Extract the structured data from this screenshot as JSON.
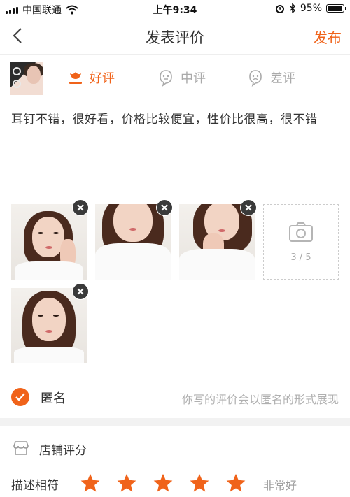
{
  "status_bar": {
    "carrier": "中国联通",
    "time": "上午9:34",
    "battery": "95%",
    "battery_level": 0.95
  },
  "nav": {
    "title": "发表评价",
    "publish_label": "发布",
    "icons": {
      "back": "chevron-left-icon"
    }
  },
  "rating_tabs": [
    {
      "label": "好评",
      "icon": "flower-icon",
      "selected": true
    },
    {
      "label": "中评",
      "icon": "neutral-face-icon",
      "selected": false
    },
    {
      "label": "差评",
      "icon": "sad-face-icon",
      "selected": false
    }
  ],
  "comment": "耳钉不错，很好看，价格比较便宜，性价比很高，很不错",
  "photos": {
    "count_label": "3 / 5"
  },
  "anonymous": {
    "label": "匿名",
    "hint": "你写的评价会以匿名的形式展现",
    "checked": true
  },
  "shop_rating": {
    "title": "店铺评分",
    "description_label": "描述相符",
    "stars": 5,
    "rating_text": "非常好"
  },
  "colors": {
    "accent": "#f0631a",
    "muted": "#aaaaaa"
  }
}
